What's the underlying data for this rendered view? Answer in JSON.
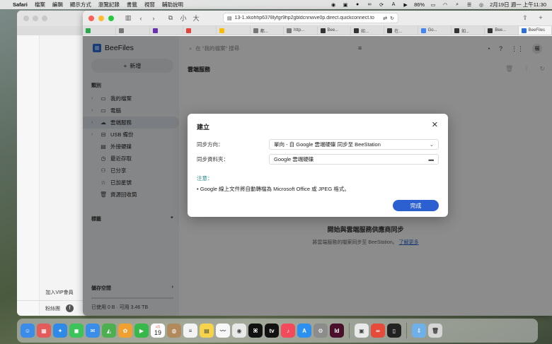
{
  "menubar": {
    "app": "Safari",
    "items": [
      "檔案",
      "編輯",
      "顯示方式",
      "瀏覽記錄",
      "書籤",
      "視窗",
      "輔助說明"
    ],
    "battery": "86%",
    "datetime": "2月19日 週一 上午11:30"
  },
  "background_window": {
    "vip": "加入VIP會員",
    "footer": "粉絲團"
  },
  "browser": {
    "text_small": "小",
    "text_large": "大",
    "url": "13-1.xkohhp6378lyfgr9hp2gbldcnnwve0p.direct.quickconnect.to",
    "tabs": [
      {
        "label": "",
        "color": "#2aa84a"
      },
      {
        "label": "",
        "color": "#777"
      },
      {
        "label": "",
        "color": "#6b2fb3"
      },
      {
        "label": "",
        "color": "#e0443b"
      },
      {
        "label": "",
        "color": "#fbbc05"
      },
      {
        "label": "都...",
        "color": "#777"
      },
      {
        "label": "http...",
        "color": "#777"
      },
      {
        "label": "Bee...",
        "color": "#333"
      },
      {
        "label": "如...",
        "color": "#333"
      },
      {
        "label": "在...",
        "color": "#333"
      },
      {
        "label": "Go...",
        "color": "#4285f4"
      },
      {
        "label": "如...",
        "color": "#333"
      },
      {
        "label": "Bee...",
        "color": "#333"
      },
      {
        "label": "BeeFiles",
        "color": "#2c6fd6"
      }
    ]
  },
  "app": {
    "name": "BeeFiles",
    "new_button": "新增",
    "search_placeholder": "在 \"我的檔案\" 搜尋",
    "avatar": "楊",
    "section_category": "類別",
    "nav": [
      {
        "label": "我的檔案",
        "icon": "folder-icon",
        "glyph": "▭",
        "chev": true,
        "active": false
      },
      {
        "label": "電腦",
        "icon": "computer-icon",
        "glyph": "▭",
        "chev": true,
        "active": false
      },
      {
        "label": "雲端服務",
        "icon": "cloud-icon",
        "glyph": "☁",
        "chev": true,
        "active": true
      },
      {
        "label": "USB 備份",
        "icon": "usb-icon",
        "glyph": "⊟",
        "chev": true,
        "active": false
      },
      {
        "label": "外接硬碟",
        "icon": "drive-icon",
        "glyph": "▤",
        "chev": false,
        "active": false
      },
      {
        "label": "最近存取",
        "icon": "clock-icon",
        "glyph": "◷",
        "chev": false,
        "active": false
      },
      {
        "label": "已分享",
        "icon": "users-icon",
        "glyph": "⚇",
        "chev": false,
        "active": false
      },
      {
        "label": "已加星號",
        "icon": "star-icon",
        "glyph": "☆",
        "chev": false,
        "active": false
      },
      {
        "label": "資源回收筒",
        "icon": "trash-icon",
        "glyph": "🗑",
        "chev": false,
        "active": false
      }
    ],
    "section_tags": "標籤",
    "storage_title": "儲存空間",
    "storage_usage": "已使用 0 B · 可用 3.46 TB",
    "breadcrumb": "雲端服務",
    "empty_title": "開始與雲端服務供應商同步",
    "empty_sub": "將雲端服務的檔案同步至 BeeStation。",
    "empty_link": "了解更多"
  },
  "modal": {
    "title": "建立",
    "direction_label": "同步方向：",
    "direction_value": "單向 - 自 Google 雲端硬碟 同步至 BeeStation",
    "folder_label": "同步資料夾：",
    "folder_value": "Google 雲端硬碟",
    "note_label": "注意：",
    "note_text": "Google 線上文件將自動轉檔為 Microsoft Office 或 JPEG 格式。",
    "done_button": "完成"
  },
  "dock": {
    "calendar_month": "2月",
    "calendar_day": "19",
    "apps": [
      {
        "name": "finder-icon",
        "bg": "#3b8be8",
        "glyph": "☺"
      },
      {
        "name": "launchpad-icon",
        "bg": "#e25c5c",
        "glyph": "▦"
      },
      {
        "name": "safari-icon",
        "bg": "#2e8ae6",
        "glyph": "✦"
      },
      {
        "name": "messages-icon",
        "bg": "#3cc35a",
        "glyph": "◼"
      },
      {
        "name": "mail-icon",
        "bg": "#3a8ee8",
        "glyph": "✉"
      },
      {
        "name": "maps-icon",
        "bg": "#4caf50",
        "glyph": "◭"
      },
      {
        "name": "photos-icon",
        "bg": "#f0a030",
        "glyph": "✿"
      },
      {
        "name": "facetime-icon",
        "bg": "#36b84a",
        "glyph": "▶"
      },
      {
        "name": "calendar-icon",
        "bg": "#ffffff",
        "glyph": ""
      },
      {
        "name": "contacts-icon",
        "bg": "#b08a5c",
        "glyph": "◍"
      },
      {
        "name": "reminders-icon",
        "bg": "#f3f3f3",
        "glyph": "≡"
      },
      {
        "name": "notes-icon",
        "bg": "#f5d34a",
        "glyph": "▤"
      },
      {
        "name": "freeform-icon",
        "bg": "#f7f7f7",
        "glyph": "〰"
      },
      {
        "name": "chrome-icon",
        "bg": "#e9e9e9",
        "glyph": "◉"
      },
      {
        "name": "scripting-icon",
        "bg": "#111111",
        "glyph": "⌘"
      },
      {
        "name": "tv-icon",
        "bg": "#111111",
        "glyph": "tv"
      },
      {
        "name": "music-icon",
        "bg": "#f24a5a",
        "glyph": "♪"
      },
      {
        "name": "appstore-icon",
        "bg": "#2d8ff0",
        "glyph": "A"
      },
      {
        "name": "settings-icon",
        "bg": "#8c8c8c",
        "glyph": "⚙"
      },
      {
        "name": "indesign-icon",
        "bg": "#4a0f2a",
        "glyph": "Id"
      },
      {
        "name": "screenshot-icon",
        "bg": "#e9e9e9",
        "glyph": "▣"
      },
      {
        "name": "creative-cloud-icon",
        "bg": "#e64a3a",
        "glyph": "∞"
      },
      {
        "name": "iphone-mirroring-icon",
        "bg": "#222222",
        "glyph": "▯"
      },
      {
        "name": "downloads-folder-icon",
        "bg": "#6fb0e8",
        "glyph": "⇩"
      },
      {
        "name": "trash-bin-icon",
        "bg": "#d5d5d5",
        "glyph": "🗑"
      }
    ]
  }
}
